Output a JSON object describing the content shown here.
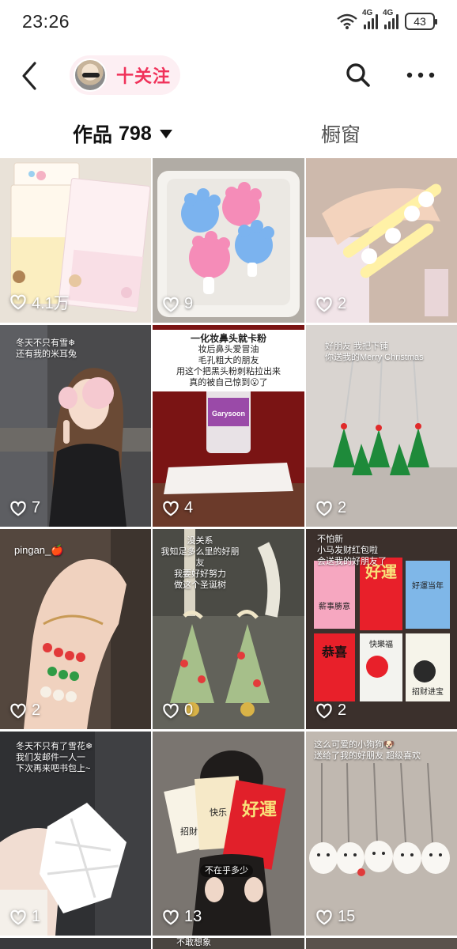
{
  "status": {
    "time": "23:26",
    "network_1": "4G",
    "network_2": "4G",
    "battery": "43"
  },
  "header": {
    "follow_label": "十关注"
  },
  "tabs": {
    "works_label": "作品",
    "works_count": "798",
    "window_label": "橱窗"
  },
  "posts": [
    {
      "likes": "4.1万"
    },
    {
      "likes": "9"
    },
    {
      "likes": "2"
    },
    {
      "likes": "7",
      "caption": [
        "冬天不只有雪❄",
        "还有我的米耳兔"
      ]
    },
    {
      "likes": "4",
      "caption": [
        "一化妆鼻头就卡粉",
        "妆后鼻头爱冒油",
        "毛孔粗大的朋友",
        "用这个把黑头粉刺粘拉出来",
        "真的被自己惊到😮了"
      ],
      "product": "Garysoon"
    },
    {
      "likes": "2",
      "caption": [
        "好朋友 我把下铺",
        "你送我的Merry Christmas"
      ]
    },
    {
      "likes": "2",
      "caption": [
        "pingan_🍎"
      ]
    },
    {
      "likes": "0",
      "caption": [
        "没关系",
        "我知足多么里的好朋友",
        "我要好好努力",
        "做这个圣诞树"
      ]
    },
    {
      "likes": "2",
      "caption": [
        "不怕新",
        "小马发财红包啦",
        "会送我的好朋友了"
      ],
      "cards": [
        "好運",
        "好運当年",
        "薪事勝意",
        "恭喜",
        "快樂福",
        "招财进宝"
      ]
    },
    {
      "likes": "1",
      "caption": [
        "冬天不只有了雪花❄",
        "我们发邮件一人一",
        "下次再来吧书包上~"
      ]
    },
    {
      "likes": "13",
      "caption": [
        "不在乎多少"
      ],
      "cards": [
        "好運",
        "快乐",
        "招財"
      ]
    },
    {
      "likes": "15",
      "caption": [
        "这么可爱的小狗狗🐶",
        "送给了我的好朋友 超级喜欢"
      ]
    }
  ],
  "bottom_peek": {
    "caption": "不敢想象"
  },
  "colors": {
    "accent": "#f0325a",
    "follow_bg": "#fdeff3"
  }
}
